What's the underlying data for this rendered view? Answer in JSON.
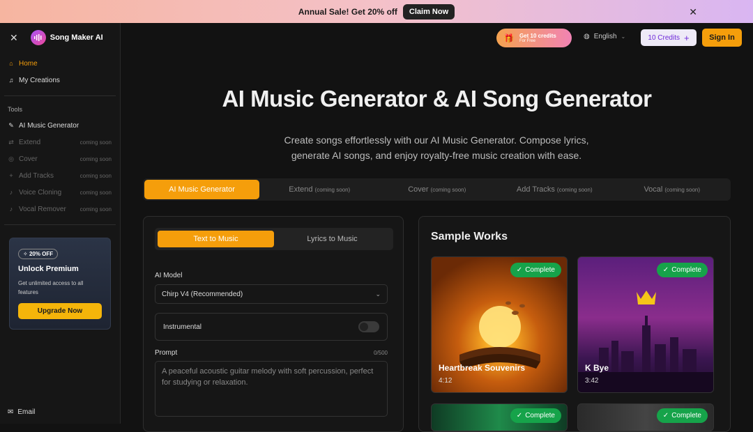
{
  "banner": {
    "text": "Annual Sale! Get 20% off",
    "button": "Claim Now"
  },
  "sidebar": {
    "brand": "Song Maker AI",
    "nav": [
      {
        "label": "Home",
        "icon": "home-icon"
      },
      {
        "label": "My Creations",
        "icon": "music-note-icon"
      }
    ],
    "tools_label": "Tools",
    "tools": [
      {
        "label": "AI Music Generator",
        "status": ""
      },
      {
        "label": "Extend",
        "status": "coming soon"
      },
      {
        "label": "Cover",
        "status": "coming soon"
      },
      {
        "label": "Add Tracks",
        "status": "coming soon"
      },
      {
        "label": "Voice Cloning",
        "status": "coming soon"
      },
      {
        "label": "Vocal Remover",
        "status": "coming soon"
      }
    ],
    "promo": {
      "badge": "20% OFF",
      "title": "Unlock Premium",
      "text": "Get unlimited access to all features",
      "button": "Upgrade Now"
    },
    "email": "Email"
  },
  "topbar": {
    "free_credits_title": "Get 10 credits",
    "free_credits_sub": "For Free",
    "language": "English",
    "credits": "10 Credits",
    "signin": "Sign In"
  },
  "hero": {
    "title": "AI Music Generator & AI Song Generator",
    "subtitle": "Create songs effortlessly with our AI Music Generator. Compose lyrics, generate AI songs, and enjoy royalty-free music creation with ease."
  },
  "tabs": [
    {
      "label": "AI Music Generator",
      "note": ""
    },
    {
      "label": "Extend",
      "note": "(coming soon)"
    },
    {
      "label": "Cover",
      "note": "(coming soon)"
    },
    {
      "label": "Add Tracks",
      "note": "(coming soon)"
    },
    {
      "label": "Vocal",
      "note": "(coming soon)"
    }
  ],
  "form": {
    "modes": [
      "Text to Music",
      "Lyrics to Music"
    ],
    "model_label": "AI Model",
    "model_value": "Chirp V4 (Recommended)",
    "instrumental_label": "Instrumental",
    "prompt_label": "Prompt",
    "prompt_count": "0/500",
    "prompt_placeholder": "A peaceful acoustic guitar melody with soft percussion, perfect for studying or relaxation."
  },
  "samples": {
    "title": "Sample Works",
    "status": "Complete",
    "items": [
      {
        "name": "Heartbreak Souvenirs",
        "duration": "4:12"
      },
      {
        "name": "K Bye",
        "duration": "3:42"
      }
    ]
  }
}
